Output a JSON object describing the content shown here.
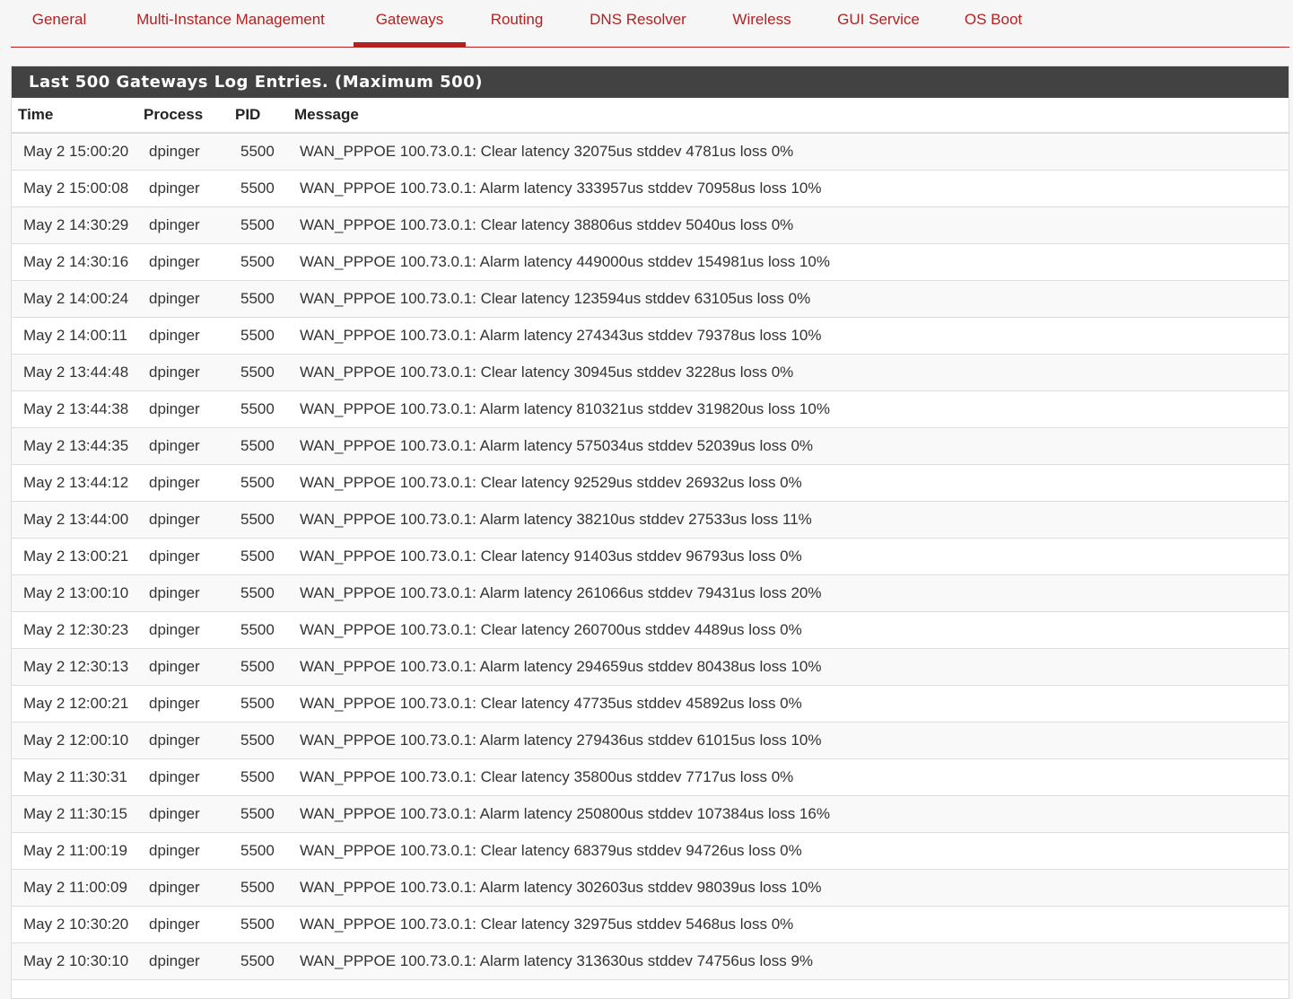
{
  "tabs": [
    {
      "label": "General",
      "active": false
    },
    {
      "label": "Multi-Instance Management",
      "active": false
    },
    {
      "label": "Gateways",
      "active": true
    },
    {
      "label": "Routing",
      "active": false
    },
    {
      "label": "DNS Resolver",
      "active": false
    },
    {
      "label": "Wireless",
      "active": false
    },
    {
      "label": "GUI Service",
      "active": false
    },
    {
      "label": "OS Boot",
      "active": false
    }
  ],
  "panel": {
    "title": "Last 500 Gateways Log Entries. (Maximum 500)"
  },
  "table": {
    "headers": {
      "time": "Time",
      "process": "Process",
      "pid": "PID",
      "message": "Message"
    },
    "rows": [
      {
        "time": "May 2 15:00:20",
        "process": "dpinger",
        "pid": "5500",
        "message": "WAN_PPPOE 100.73.0.1: Clear latency 32075us stddev 4781us loss 0%"
      },
      {
        "time": "May 2 15:00:08",
        "process": "dpinger",
        "pid": "5500",
        "message": "WAN_PPPOE 100.73.0.1: Alarm latency 333957us stddev 70958us loss 10%"
      },
      {
        "time": "May 2 14:30:29",
        "process": "dpinger",
        "pid": "5500",
        "message": "WAN_PPPOE 100.73.0.1: Clear latency 38806us stddev 5040us loss 0%"
      },
      {
        "time": "May 2 14:30:16",
        "process": "dpinger",
        "pid": "5500",
        "message": "WAN_PPPOE 100.73.0.1: Alarm latency 449000us stddev 154981us loss 10%"
      },
      {
        "time": "May 2 14:00:24",
        "process": "dpinger",
        "pid": "5500",
        "message": "WAN_PPPOE 100.73.0.1: Clear latency 123594us stddev 63105us loss 0%"
      },
      {
        "time": "May 2 14:00:11",
        "process": "dpinger",
        "pid": "5500",
        "message": "WAN_PPPOE 100.73.0.1: Alarm latency 274343us stddev 79378us loss 10%"
      },
      {
        "time": "May 2 13:44:48",
        "process": "dpinger",
        "pid": "5500",
        "message": "WAN_PPPOE 100.73.0.1: Clear latency 30945us stddev 3228us loss 0%"
      },
      {
        "time": "May 2 13:44:38",
        "process": "dpinger",
        "pid": "5500",
        "message": "WAN_PPPOE 100.73.0.1: Alarm latency 810321us stddev 319820us loss 10%"
      },
      {
        "time": "May 2 13:44:35",
        "process": "dpinger",
        "pid": "5500",
        "message": "WAN_PPPOE 100.73.0.1: Alarm latency 575034us stddev 52039us loss 0%"
      },
      {
        "time": "May 2 13:44:12",
        "process": "dpinger",
        "pid": "5500",
        "message": "WAN_PPPOE 100.73.0.1: Clear latency 92529us stddev 26932us loss 0%"
      },
      {
        "time": "May 2 13:44:00",
        "process": "dpinger",
        "pid": "5500",
        "message": "WAN_PPPOE 100.73.0.1: Alarm latency 38210us stddev 27533us loss 11%"
      },
      {
        "time": "May 2 13:00:21",
        "process": "dpinger",
        "pid": "5500",
        "message": "WAN_PPPOE 100.73.0.1: Clear latency 91403us stddev 96793us loss 0%"
      },
      {
        "time": "May 2 13:00:10",
        "process": "dpinger",
        "pid": "5500",
        "message": "WAN_PPPOE 100.73.0.1: Alarm latency 261066us stddev 79431us loss 20%"
      },
      {
        "time": "May 2 12:30:23",
        "process": "dpinger",
        "pid": "5500",
        "message": "WAN_PPPOE 100.73.0.1: Clear latency 260700us stddev 4489us loss 0%"
      },
      {
        "time": "May 2 12:30:13",
        "process": "dpinger",
        "pid": "5500",
        "message": "WAN_PPPOE 100.73.0.1: Alarm latency 294659us stddev 80438us loss 10%"
      },
      {
        "time": "May 2 12:00:21",
        "process": "dpinger",
        "pid": "5500",
        "message": "WAN_PPPOE 100.73.0.1: Clear latency 47735us stddev 45892us loss 0%"
      },
      {
        "time": "May 2 12:00:10",
        "process": "dpinger",
        "pid": "5500",
        "message": "WAN_PPPOE 100.73.0.1: Alarm latency 279436us stddev 61015us loss 10%"
      },
      {
        "time": "May 2 11:30:31",
        "process": "dpinger",
        "pid": "5500",
        "message": "WAN_PPPOE 100.73.0.1: Clear latency 35800us stddev 7717us loss 0%"
      },
      {
        "time": "May 2 11:30:15",
        "process": "dpinger",
        "pid": "5500",
        "message": "WAN_PPPOE 100.73.0.1: Alarm latency 250800us stddev 107384us loss 16%"
      },
      {
        "time": "May 2 11:00:19",
        "process": "dpinger",
        "pid": "5500",
        "message": "WAN_PPPOE 100.73.0.1: Clear latency 68379us stddev 94726us loss 0%"
      },
      {
        "time": "May 2 11:00:09",
        "process": "dpinger",
        "pid": "5500",
        "message": "WAN_PPPOE 100.73.0.1: Alarm latency 302603us stddev 98039us loss 10%"
      },
      {
        "time": "May 2 10:30:20",
        "process": "dpinger",
        "pid": "5500",
        "message": "WAN_PPPOE 100.73.0.1: Clear latency 32975us stddev 5468us loss 0%"
      },
      {
        "time": "May 2 10:30:10",
        "process": "dpinger",
        "pid": "5500",
        "message": "WAN_PPPOE 100.73.0.1: Alarm latency 313630us stddev 74756us loss 9%"
      }
    ]
  },
  "colors": {
    "accent": "#b22222",
    "panel_heading_bg": "#424242",
    "page_bg": "#f6f6f6"
  }
}
